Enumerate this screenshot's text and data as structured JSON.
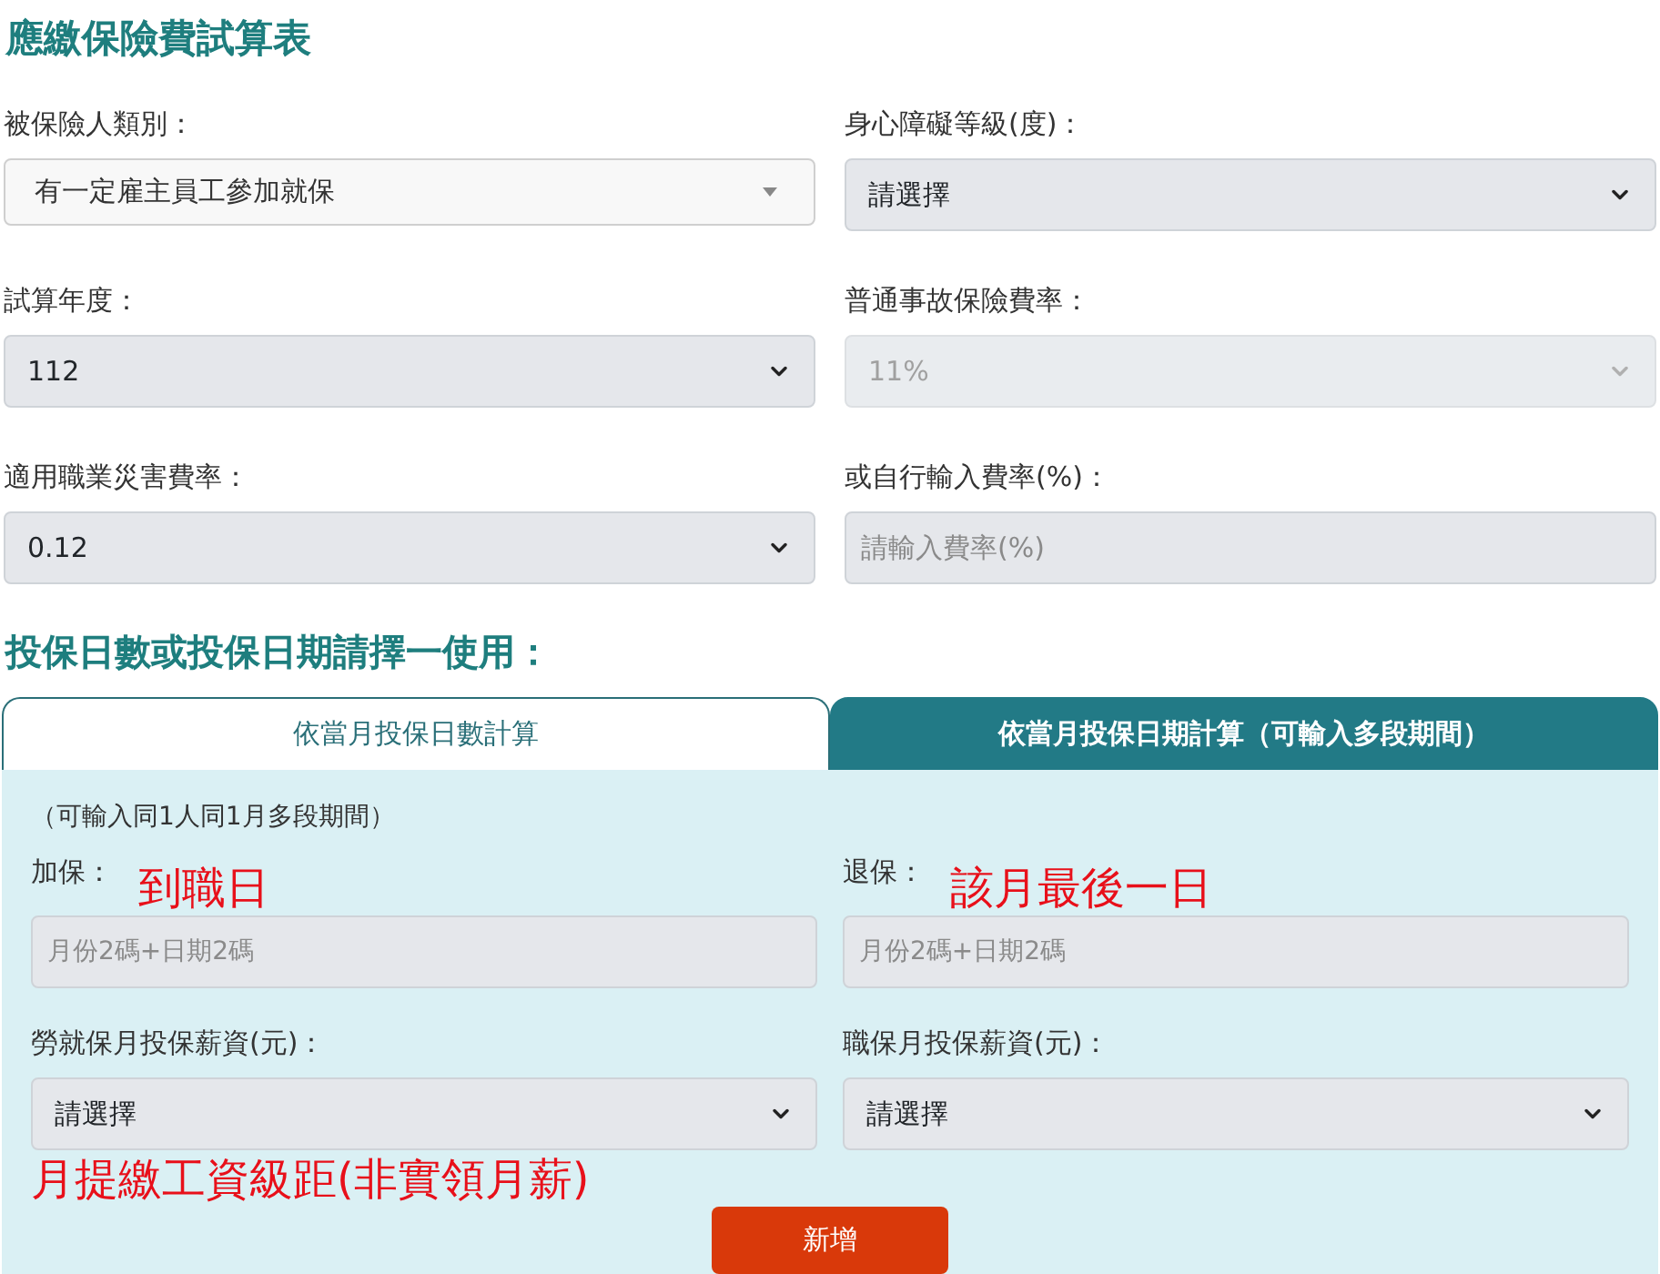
{
  "title": "應繳保險費試算表",
  "fields": [
    {
      "label": "被保險人類別：",
      "kind": "combobox",
      "value": "有一定雇主員工參加就保",
      "disabled": false
    },
    {
      "label": "身心障礙等級(度)：",
      "kind": "select",
      "value": "請選擇",
      "disabled": false
    },
    {
      "label": "試算年度：",
      "kind": "select",
      "value": "112",
      "disabled": false
    },
    {
      "label": "普通事故保險費率：",
      "kind": "select",
      "value": "11%",
      "disabled": true
    },
    {
      "label": "適用職業災害費率：",
      "kind": "select",
      "value": "0.12",
      "disabled": false
    },
    {
      "label": "或自行輸入費率(%)：",
      "kind": "input",
      "placeholder": "請輸入費率(%)",
      "disabled": false
    }
  ],
  "section_heading": "投保日數或投保日期請擇一使用：",
  "tabs": [
    {
      "label": "依當月投保日數計算",
      "selected": false
    },
    {
      "label": "依當月投保日期計算（可輸入多段期間）",
      "selected": true
    }
  ],
  "panel": {
    "note": "（可輸入同1人同1月多段期間）",
    "date_fields": [
      {
        "label": "加保：",
        "placeholder": "月份2碼+日期2碼",
        "annotation": "到職日"
      },
      {
        "label": "退保：",
        "placeholder": "月份2碼+日期2碼",
        "annotation": "該月最後一日"
      }
    ],
    "wage_fields": [
      {
        "label": "勞就保月投保薪資(元)：",
        "value": "請選擇"
      },
      {
        "label": "職保月投保薪資(元)：",
        "value": "請選擇"
      }
    ],
    "wage_annotation": "月提繳工資級距(非實領月薪)",
    "add_button": "新增"
  }
}
